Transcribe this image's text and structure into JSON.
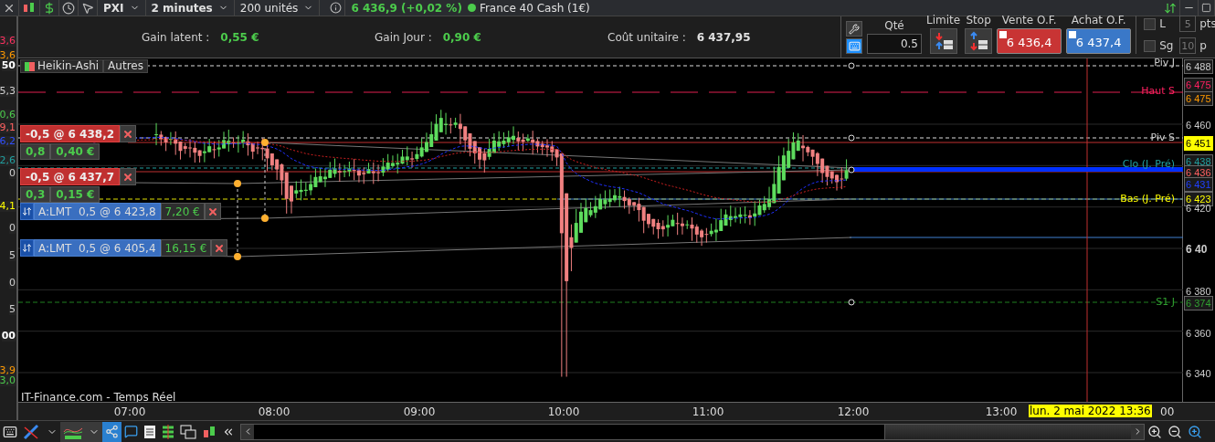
{
  "toolbar": {
    "symbol": "PXI",
    "timeframe": "2 minutes",
    "units": "200 unités",
    "quote": "6 436,9 (+0,02 %)",
    "instrument": "France 40 Cash (1€)"
  },
  "stats": [
    {
      "label": "Gain latent :",
      "value": "0,55 €",
      "kind": "gain"
    },
    {
      "label": "Gain Jour :",
      "value": "0,90 €",
      "kind": "gain"
    },
    {
      "label": "Coût unitaire :",
      "value": "6 437,95",
      "kind": "plain"
    }
  ],
  "order_panel": {
    "qty_label": "Qté",
    "qty": "0.5",
    "limit_label": "Limite",
    "stop_label": "Stop",
    "sell": {
      "label": "Vente O.F.",
      "price": "6 436,4"
    },
    "buy": {
      "label": "Achat O.F.",
      "price": "6 437,4"
    },
    "options": [
      {
        "label": "L",
        "checked": false,
        "points": "5",
        "unit": "pts"
      },
      {
        "label": "Sg",
        "checked": false,
        "points": "10",
        "unit": "p"
      }
    ]
  },
  "left_scale": [
    {
      "text": "3,6",
      "color": "#ff3060"
    },
    {
      "text": "3,6",
      "color": "#ff9900"
    },
    {
      "text": "50",
      "color": "#ffffff"
    },
    {
      "text": "5,3",
      "color": "#d0d0d0"
    },
    {
      "text": "0,6",
      "color": "#4ccc4c"
    },
    {
      "text": "9,1",
      "color": "#ff6060"
    },
    {
      "text": "6,2",
      "color": "#3050ff"
    },
    {
      "text": "2,6",
      "color": "#20a0a0"
    },
    {
      "text": "0",
      "color": "#d0d0d0"
    },
    {
      "text": "4,1",
      "color": "#ffff00"
    },
    {
      "text": "0",
      "color": "#d0d0d0"
    },
    {
      "text": "5",
      "color": "#d0d0d0"
    },
    {
      "text": "0",
      "color": "#d0d0d0"
    },
    {
      "text": "5",
      "color": "#d0d0d0"
    },
    {
      "text": "00",
      "color": "#ffffff"
    },
    {
      "text": "3,9",
      "color": "#ff9900"
    },
    {
      "text": "3,0",
      "color": "#4ccc4c"
    }
  ],
  "chart": {
    "tabs": [
      {
        "label": "Heikin-Ashi"
      },
      {
        "label": "Autres"
      }
    ],
    "source": "IT-Finance.com - Temps Réel",
    "level_labels": [
      {
        "text": "Piv J",
        "color": "#d0d0d0"
      },
      {
        "text": "Haut S",
        "color": "#ff2060"
      },
      {
        "text": "Piv S",
        "color": "#d0d0d0"
      },
      {
        "text": "Clo (J. Pré)",
        "color": "#20a0a0"
      },
      {
        "text": "Bas (J. Pré)",
        "color": "#ffff00"
      },
      {
        "text": "S1 J",
        "color": "#30a030"
      }
    ],
    "positions": [
      {
        "label": "-0,5 @ 6 438,2",
        "qty": "0,8",
        "pnl": "0,40 €"
      },
      {
        "label": "-0,5 @ 6 437,7",
        "qty": "0,3",
        "pnl": "0,15 €"
      }
    ],
    "orders": [
      {
        "label": "A:LMT  0,5 @ 6 423,8",
        "pnl": "7,20 €"
      },
      {
        "label": "A:LMT  0,5 @ 6 405,4",
        "pnl": "16,15 €"
      }
    ],
    "price_axis": [
      {
        "text": "6 488",
        "kind": "tag"
      },
      {
        "text": "6 475",
        "kind": "tag",
        "color": "#ff2060"
      },
      {
        "text": "6 475",
        "kind": "tag",
        "color": "#ff9900"
      },
      {
        "text": "6 460",
        "kind": "tick"
      },
      {
        "text": "6 451",
        "kind": "highlight"
      },
      {
        "text": "6 438",
        "kind": "tag",
        "color": "#20a0a0"
      },
      {
        "text": "6 436",
        "kind": "tag",
        "color": "#ff6060"
      },
      {
        "text": "6 431",
        "kind": "tag",
        "color": "#2040ff"
      },
      {
        "text": "6 423",
        "kind": "tag",
        "color": "#ffff00"
      },
      {
        "text": "6 420",
        "kind": "tick"
      },
      {
        "text": "6 40",
        "kind": "major"
      },
      {
        "text": "6 380",
        "kind": "tick"
      },
      {
        "text": "6 374",
        "kind": "tag",
        "color": "#30a030"
      },
      {
        "text": "6 360",
        "kind": "tick"
      },
      {
        "text": "6 340",
        "kind": "tick"
      }
    ],
    "time_axis": [
      "07:00",
      "08:00",
      "09:00",
      "10:00",
      "11:00",
      "12:00",
      "13:00"
    ],
    "cursor_time": "lun. 2 mai 2022 13:36",
    "time_axis_tail": "00"
  }
}
